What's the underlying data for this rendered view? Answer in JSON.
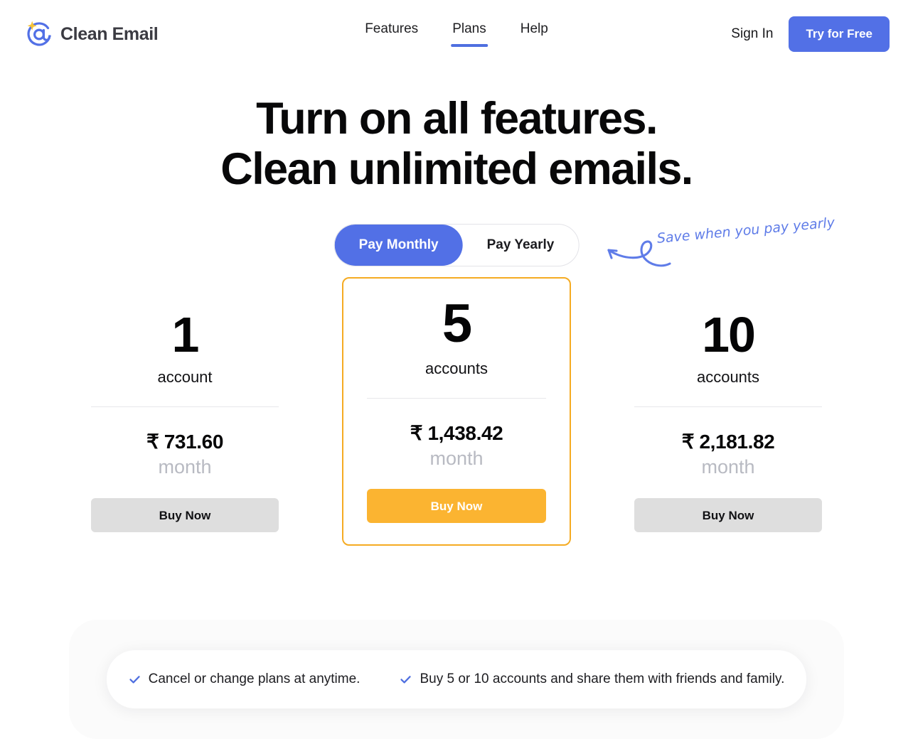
{
  "brand": {
    "name": "Clean Email",
    "logo_icon": "at-sparkle-icon",
    "accent_blue": "#5270e6",
    "accent_gold": "#fbb431"
  },
  "nav": {
    "items": [
      {
        "label": "Features",
        "active": false
      },
      {
        "label": "Plans",
        "active": true
      },
      {
        "label": "Help",
        "active": false
      }
    ]
  },
  "header_actions": {
    "sign_in": "Sign In",
    "try_free": "Try for Free"
  },
  "hero": {
    "line1": "Turn on all features.",
    "line2": "Clean unlimited emails."
  },
  "billing_toggle": {
    "monthly": "Pay Monthly",
    "yearly": "Pay Yearly",
    "selected": "Pay Monthly",
    "annotation": "Save when you pay yearly",
    "annotation_icon": "curly-arrow-icon",
    "annotation_color": "#5f7ce8"
  },
  "plans": [
    {
      "count": "1",
      "unit": "account",
      "price": "₹ 731.60",
      "period": "month",
      "buy_label": "Buy Now",
      "featured": false
    },
    {
      "count": "5",
      "unit": "accounts",
      "price": "₹ 1,438.42",
      "period": "month",
      "buy_label": "Buy Now",
      "featured": true
    },
    {
      "count": "10",
      "unit": "accounts",
      "price": "₹ 2,181.82",
      "period": "month",
      "buy_label": "Buy Now",
      "featured": false
    }
  ],
  "benefits": [
    {
      "icon": "check-icon",
      "text": "Cancel or change plans at anytime."
    },
    {
      "icon": "check-icon",
      "text": "Buy 5 or 10 accounts and share them with friends and family."
    }
  ]
}
